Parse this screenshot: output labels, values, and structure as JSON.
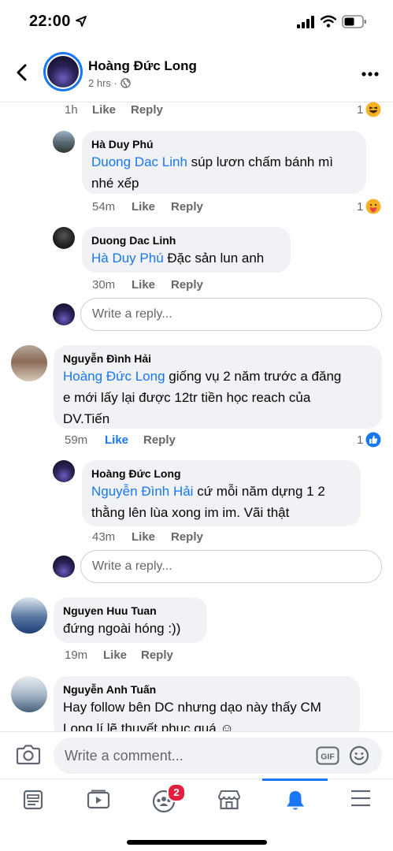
{
  "status_bar": {
    "time": "22:00"
  },
  "header": {
    "name": "Hoàng Đức Long",
    "meta": "2 hrs ·"
  },
  "comments": {
    "top_actions": {
      "time": "1h",
      "like": "Like",
      "reply": "Reply",
      "reaction_count": "1",
      "reaction": "haha"
    },
    "phu": {
      "author": "Hà Duy Phú",
      "mention": "Duong Dac Linh",
      "text_line1": " súp lươn chấm bánh mì",
      "text_line2": "nhé xếp",
      "time": "54m",
      "like": "Like",
      "reply": "Reply",
      "reaction_count": "1",
      "reaction": "care"
    },
    "linh": {
      "author": "Duong Dac Linh",
      "mention": "Hà Duy Phú",
      "text": " Đặc sản lun anh",
      "time": "30m",
      "like": "Like",
      "reply": "Reply"
    },
    "reply_box_1": {
      "placeholder": "Write a reply..."
    },
    "hai": {
      "author": "Nguyễn Đình Hải",
      "mention": "Hoàng Đức Long",
      "text_line1": " giống vụ 2 năm trước a đăng",
      "text_line2": "e mới lấy lại được 12tr tiền học reach của",
      "text_line3": "DV.Tiến",
      "time": "59m",
      "like": "Like",
      "reply": "Reply",
      "reaction_count": "1",
      "reaction": "like"
    },
    "long_reply": {
      "author": "Hoàng Đức Long",
      "mention": "Nguyễn Đình Hải",
      "text_line1": "  cứ mỗi năm dựng 1 2",
      "text_line2": "thằng lên lùa xong im im. Vãi thật",
      "time": "43m",
      "like": "Like",
      "reply": "Reply"
    },
    "reply_box_2": {
      "placeholder": "Write a reply..."
    },
    "tuan": {
      "author": "Nguyen Huu Tuan",
      "text": "đứng ngoài hóng :))",
      "time": "19m",
      "like": "Like",
      "reply": "Reply"
    },
    "atuan": {
      "author": "Nguyễn Anh Tuấn",
      "text_line1": "Hay follow bên DC nhưng dạo này thấy CM",
      "text_line2": "Long lí lẽ thuyết phục quá"
    }
  },
  "composer": {
    "placeholder": "Write a comment...",
    "gif_label": "GIF"
  },
  "tabbar": {
    "tabs": [
      "news-feed",
      "watch",
      "groups",
      "marketplace",
      "notifications",
      "menu"
    ],
    "active": "notifications",
    "groups_badge": "2"
  },
  "colors": {
    "accent": "#1877f2",
    "bubble": "#f0f2f5",
    "secondary_text": "#65676b",
    "badge": "#e41e3f"
  }
}
